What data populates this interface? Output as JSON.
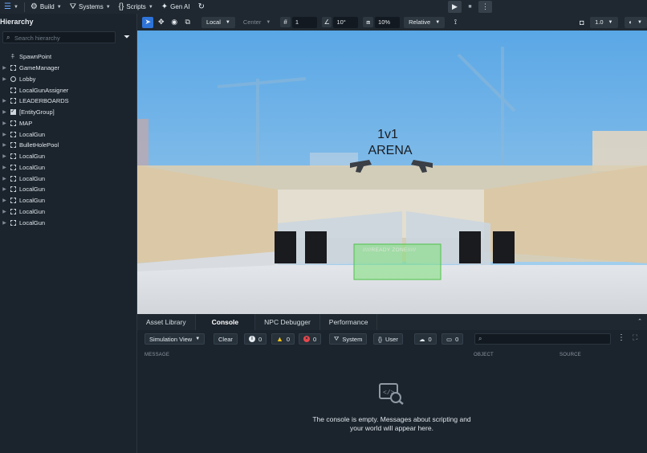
{
  "menubar": {
    "items": [
      {
        "label": "Build",
        "icon": "build-icon"
      },
      {
        "label": "Systems",
        "icon": "systems-icon"
      },
      {
        "label": "Scripts",
        "icon": "scripts-icon"
      },
      {
        "label": "Gen AI",
        "icon": "genai-icon"
      }
    ]
  },
  "hierarchy": {
    "title": "Hierarchy",
    "search_placeholder": "Search hierarchy",
    "items": [
      {
        "label": "SpawnPoint",
        "icon": "spawn-icon",
        "expandable": false
      },
      {
        "label": "GameManager",
        "icon": "box-icon",
        "expandable": true
      },
      {
        "label": "Lobby",
        "icon": "ring-icon",
        "expandable": true
      },
      {
        "label": "LocalGunAssigner",
        "icon": "box-icon",
        "expandable": false
      },
      {
        "label": "LEADERBOARDS",
        "icon": "box-icon",
        "expandable": true
      },
      {
        "label": "[EntityGroup]",
        "icon": "check-icon",
        "expandable": true
      },
      {
        "label": "MAP",
        "icon": "box-icon",
        "expandable": true
      },
      {
        "label": "LocalGun",
        "icon": "box-icon",
        "expandable": true
      },
      {
        "label": "BulletHolePool",
        "icon": "box-icon",
        "expandable": true
      },
      {
        "label": "LocalGun",
        "icon": "box-icon",
        "expandable": true
      },
      {
        "label": "LocalGun",
        "icon": "box-icon",
        "expandable": true
      },
      {
        "label": "LocalGun",
        "icon": "box-icon",
        "expandable": true
      },
      {
        "label": "LocalGun",
        "icon": "box-icon",
        "expandable": true
      },
      {
        "label": "LocalGun",
        "icon": "box-icon",
        "expandable": true
      },
      {
        "label": "LocalGun",
        "icon": "box-icon",
        "expandable": true
      },
      {
        "label": "LocalGun",
        "icon": "box-icon",
        "expandable": true
      }
    ]
  },
  "scene_toolbar": {
    "space": "Local",
    "pivot": "Center",
    "grid_value": "1",
    "angle_value": "10°",
    "scale_value": "10%",
    "snap_mode": "Relative",
    "camera_speed": "1.0"
  },
  "viewport": {
    "arena_line1": "1v1",
    "arena_line2": "ARENA",
    "ready_zone": "/////READY ZONE/////"
  },
  "bottom_tabs": [
    {
      "label": "Asset Library",
      "active": false
    },
    {
      "label": "Console",
      "active": true
    },
    {
      "label": "NPC Debugger",
      "active": false
    },
    {
      "label": "Performance",
      "active": false
    }
  ],
  "console": {
    "view_mode": "Simulation View",
    "clear_label": "Clear",
    "info_count": "0",
    "warning_count": "0",
    "error_count": "0",
    "system_label": "System",
    "user_label": "User",
    "server_count": "0",
    "client_count": "0",
    "columns": {
      "message": "MESSAGE",
      "object": "OBJECT",
      "source": "SOURCE"
    },
    "empty_message": "The console is empty. Messages about scripting and your world will appear here."
  },
  "colors": {
    "accent": "#2e73d8",
    "panel": "#1b232c",
    "info": "#e6ebf0",
    "warning": "#f0c419",
    "error": "#e5484d"
  }
}
